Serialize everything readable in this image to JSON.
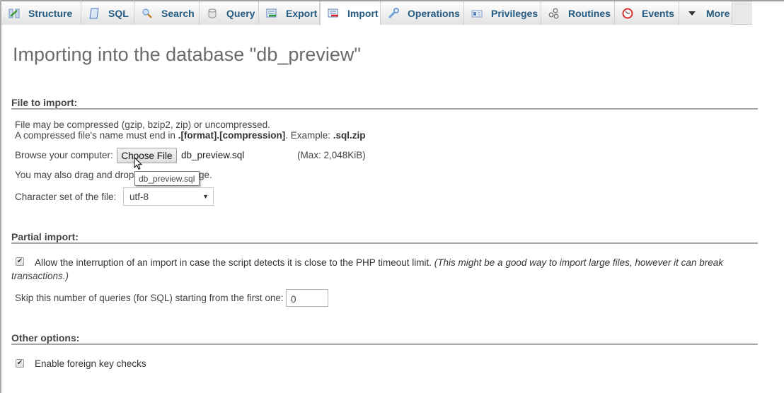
{
  "tabs": [
    {
      "label": "Structure",
      "icon": "structure-icon",
      "active": false
    },
    {
      "label": "SQL",
      "icon": "sql-icon",
      "active": false
    },
    {
      "label": "Search",
      "icon": "search-icon",
      "active": false
    },
    {
      "label": "Query",
      "icon": "query-icon",
      "active": false
    },
    {
      "label": "Export",
      "icon": "export-icon",
      "active": false
    },
    {
      "label": "Import",
      "icon": "import-icon",
      "active": true
    },
    {
      "label": "Operations",
      "icon": "wrench-icon",
      "active": false
    },
    {
      "label": "Privileges",
      "icon": "privileges-icon",
      "active": false
    },
    {
      "label": "Routines",
      "icon": "routines-icon",
      "active": false
    },
    {
      "label": "Events",
      "icon": "events-clock-icon",
      "active": false
    },
    {
      "label": "More",
      "icon": "triangle-down-icon",
      "active": false
    }
  ],
  "page_title": "Importing into the database \"db_preview\"",
  "file_section": {
    "legend": "File to import:",
    "compress_note": "File may be compressed (gzip, bzip2, zip) or uncompressed.",
    "name_note_prefix": "A compressed file's name must end in ",
    "name_note_format": ".[format].[compression]",
    "name_note_mid": ". Example: ",
    "name_note_example": ".sql.zip",
    "browse_label": "Browse your computer:",
    "choose_file_button": "Choose File",
    "chosen_file": "db_preview.sql",
    "max_size": "(Max: 2,048KiB)",
    "drag_drop_visible_start": "You may also drag and drop",
    "drag_drop_visible_end": "ge.",
    "tooltip": "db_preview.sql",
    "charset_label": "Character set of the file:",
    "charset_value": "utf-8"
  },
  "partial_section": {
    "legend": "Partial import:",
    "allow_interrupt_checked": true,
    "allow_interrupt_label": "Allow the interruption of an import in case the script detects it is close to the PHP timeout limit.",
    "allow_interrupt_note_1": "(This might be a good way to import large files, however it can break",
    "allow_interrupt_note_2": "transactions.)",
    "skip_label": "Skip this number of queries (for SQL) starting from the first one:",
    "skip_value": "0"
  },
  "other_section": {
    "legend": "Other options:",
    "fk_checked": true,
    "fk_label": "Enable foreign key checks"
  }
}
